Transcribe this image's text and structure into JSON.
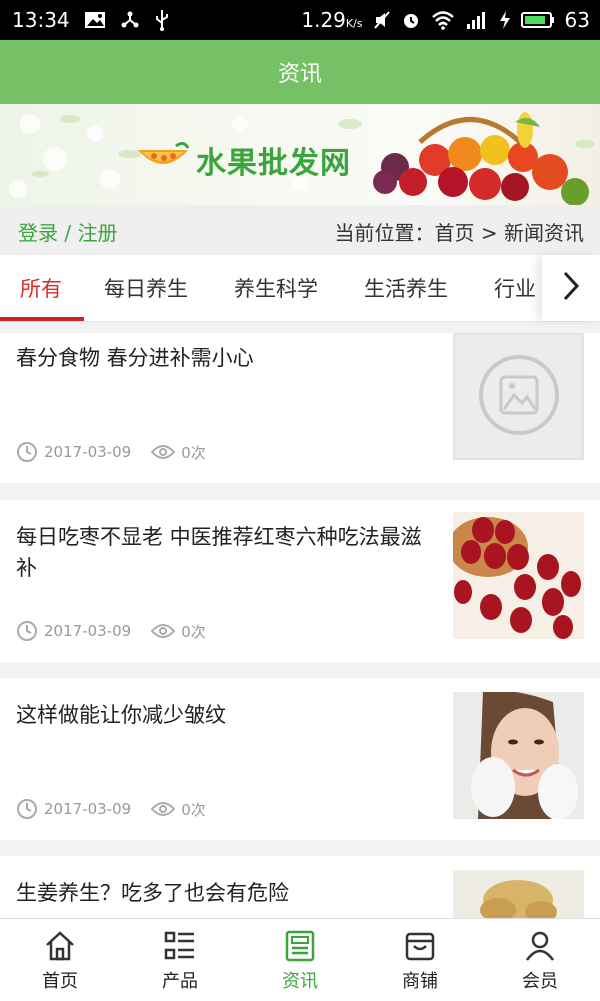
{
  "status_bar": {
    "time": "13:34",
    "speed": "1.29",
    "speed_unit": "K/s",
    "battery": "63"
  },
  "header": {
    "title": "资讯"
  },
  "banner": {
    "site_name": "水果批发网"
  },
  "crumb": {
    "login": "登录",
    "separator": " / ",
    "register": "注册",
    "location": "当前位置：首页 > 新闻资讯"
  },
  "tabs": [
    {
      "label": "所有"
    },
    {
      "label": "每日养生"
    },
    {
      "label": "养生科学"
    },
    {
      "label": "生活养生"
    },
    {
      "label": "行业"
    }
  ],
  "news": [
    {
      "title": "春分食物 春分进补需小心",
      "date": "2017-03-09",
      "views": "0次",
      "thumb": "placeholder"
    },
    {
      "title": "每日吃枣不显老 中医推荐红枣六种吃法最滋补",
      "date": "2017-03-09",
      "views": "0次",
      "thumb": "red-dates"
    },
    {
      "title": "这样做能让你减少皱纹",
      "date": "2017-03-09",
      "views": "0次",
      "thumb": "face"
    },
    {
      "title": "生姜养生？吃多了也会有危险",
      "date": "",
      "views": "",
      "thumb": "ginger"
    }
  ],
  "bottom_nav": [
    {
      "label": "首页",
      "icon": "home-icon"
    },
    {
      "label": "产品",
      "icon": "list-icon"
    },
    {
      "label": "资讯",
      "icon": "news-icon",
      "active": true
    },
    {
      "label": "商铺",
      "icon": "shop-icon"
    },
    {
      "label": "会员",
      "icon": "user-icon"
    }
  ],
  "colors": {
    "accent": "#76c166",
    "brand_green": "#3aa53b",
    "tab_active": "#d61f1f"
  }
}
